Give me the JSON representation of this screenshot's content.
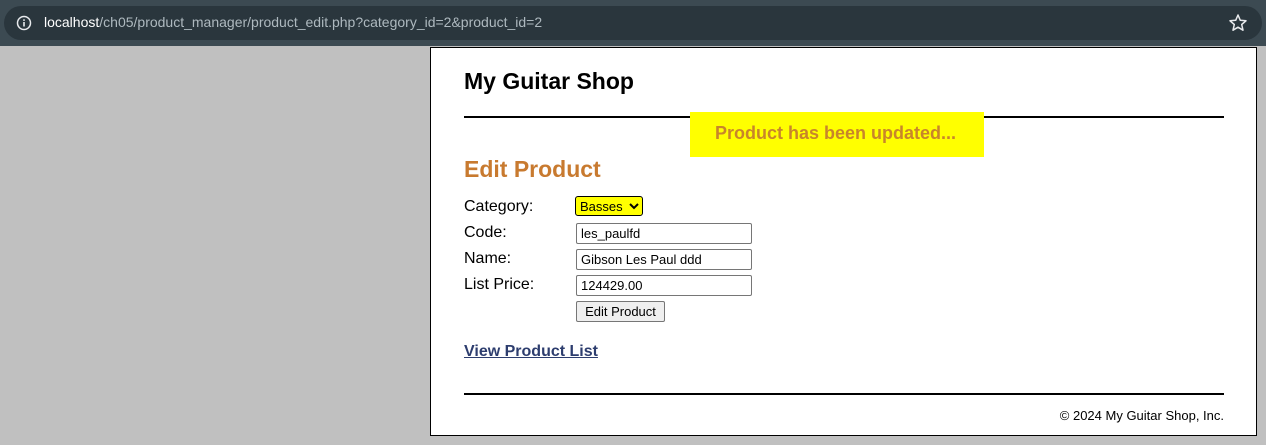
{
  "browser": {
    "url_host": "localhost",
    "url_path": "/ch05/product_manager/product_edit.php?category_id=2&product_id=2"
  },
  "page": {
    "site_title": "My Guitar Shop",
    "message": "Product has been updated...",
    "heading": "Edit Product",
    "form": {
      "category_label": "Category:",
      "category_value": "Basses",
      "code_label": "Code:",
      "code_value": "les_paulfd",
      "name_label": "Name:",
      "name_value": "Gibson Les Paul ddd",
      "price_label": "List Price:",
      "price_value": "124429.00",
      "submit_label": "Edit Product"
    },
    "link_text": "View Product List",
    "footer": "© 2024 My Guitar Shop, Inc."
  },
  "colors": {
    "highlight": "#ffff00",
    "heading": "#c87a2f",
    "link": "#2d3d6e"
  }
}
